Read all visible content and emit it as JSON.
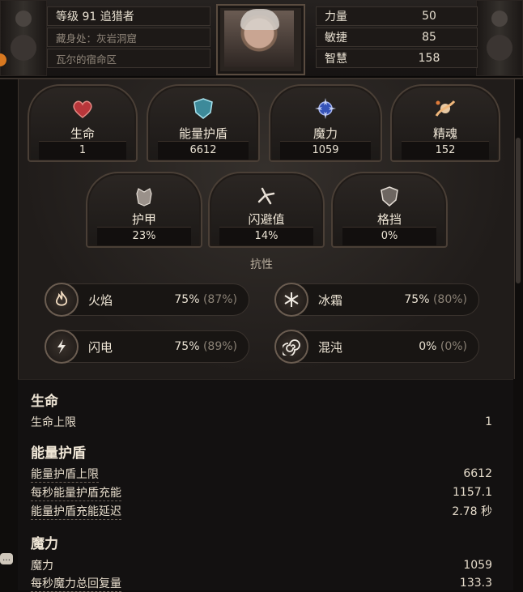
{
  "header": {
    "level_line": "等级 91 追猎者",
    "hideout": "藏身处：灰岩洞窟",
    "location": "瓦尔的宿命区"
  },
  "attributes": [
    {
      "label": "力量",
      "value": "50"
    },
    {
      "label": "敏捷",
      "value": "85"
    },
    {
      "label": "智慧",
      "value": "158"
    }
  ],
  "primary_cards": [
    {
      "label": "生命",
      "value": "1",
      "icon": "heart-icon"
    },
    {
      "label": "能量护盾",
      "value": "6612",
      "icon": "shield-icon"
    },
    {
      "label": "魔力",
      "value": "1059",
      "icon": "mana-icon"
    },
    {
      "label": "精魂",
      "value": "152",
      "icon": "spirit-icon"
    }
  ],
  "defense_cards": [
    {
      "label": "护甲",
      "value": "23%",
      "icon": "armour-icon"
    },
    {
      "label": "闪避值",
      "value": "14%",
      "icon": "evasion-icon"
    },
    {
      "label": "格挡",
      "value": "0%",
      "icon": "block-icon"
    }
  ],
  "resistances": {
    "title": "抗性",
    "items": [
      {
        "label": "火焰",
        "value": "75%",
        "cap": "(87%)",
        "icon": "fire-icon",
        "color": "#d9762b"
      },
      {
        "label": "冰霜",
        "value": "75%",
        "cap": "(80%)",
        "icon": "cold-icon",
        "color": "#5f9ad1"
      },
      {
        "label": "闪电",
        "value": "75%",
        "cap": "(89%)",
        "icon": "lightning-icon",
        "color": "#e0c24a"
      },
      {
        "label": "混沌",
        "value": "0%",
        "cap": "(0%)",
        "icon": "chaos-icon",
        "color": "#b06bd0"
      }
    ]
  },
  "stats": {
    "life": {
      "title": "生命",
      "rows": [
        {
          "label": "生命上限",
          "value": "1"
        }
      ]
    },
    "es": {
      "title": "能量护盾",
      "rows": [
        {
          "label": "能量护盾上限",
          "value": "6612"
        },
        {
          "label": "每秒能量护盾充能",
          "value": "1157.1"
        },
        {
          "label": "能量护盾充能延迟",
          "value": "2.78 秒"
        }
      ]
    },
    "mana": {
      "title": "魔力",
      "rows": [
        {
          "label": "魔力",
          "value": "1059"
        },
        {
          "label": "每秒魔力总回复量",
          "value": "133.3"
        }
      ]
    }
  }
}
